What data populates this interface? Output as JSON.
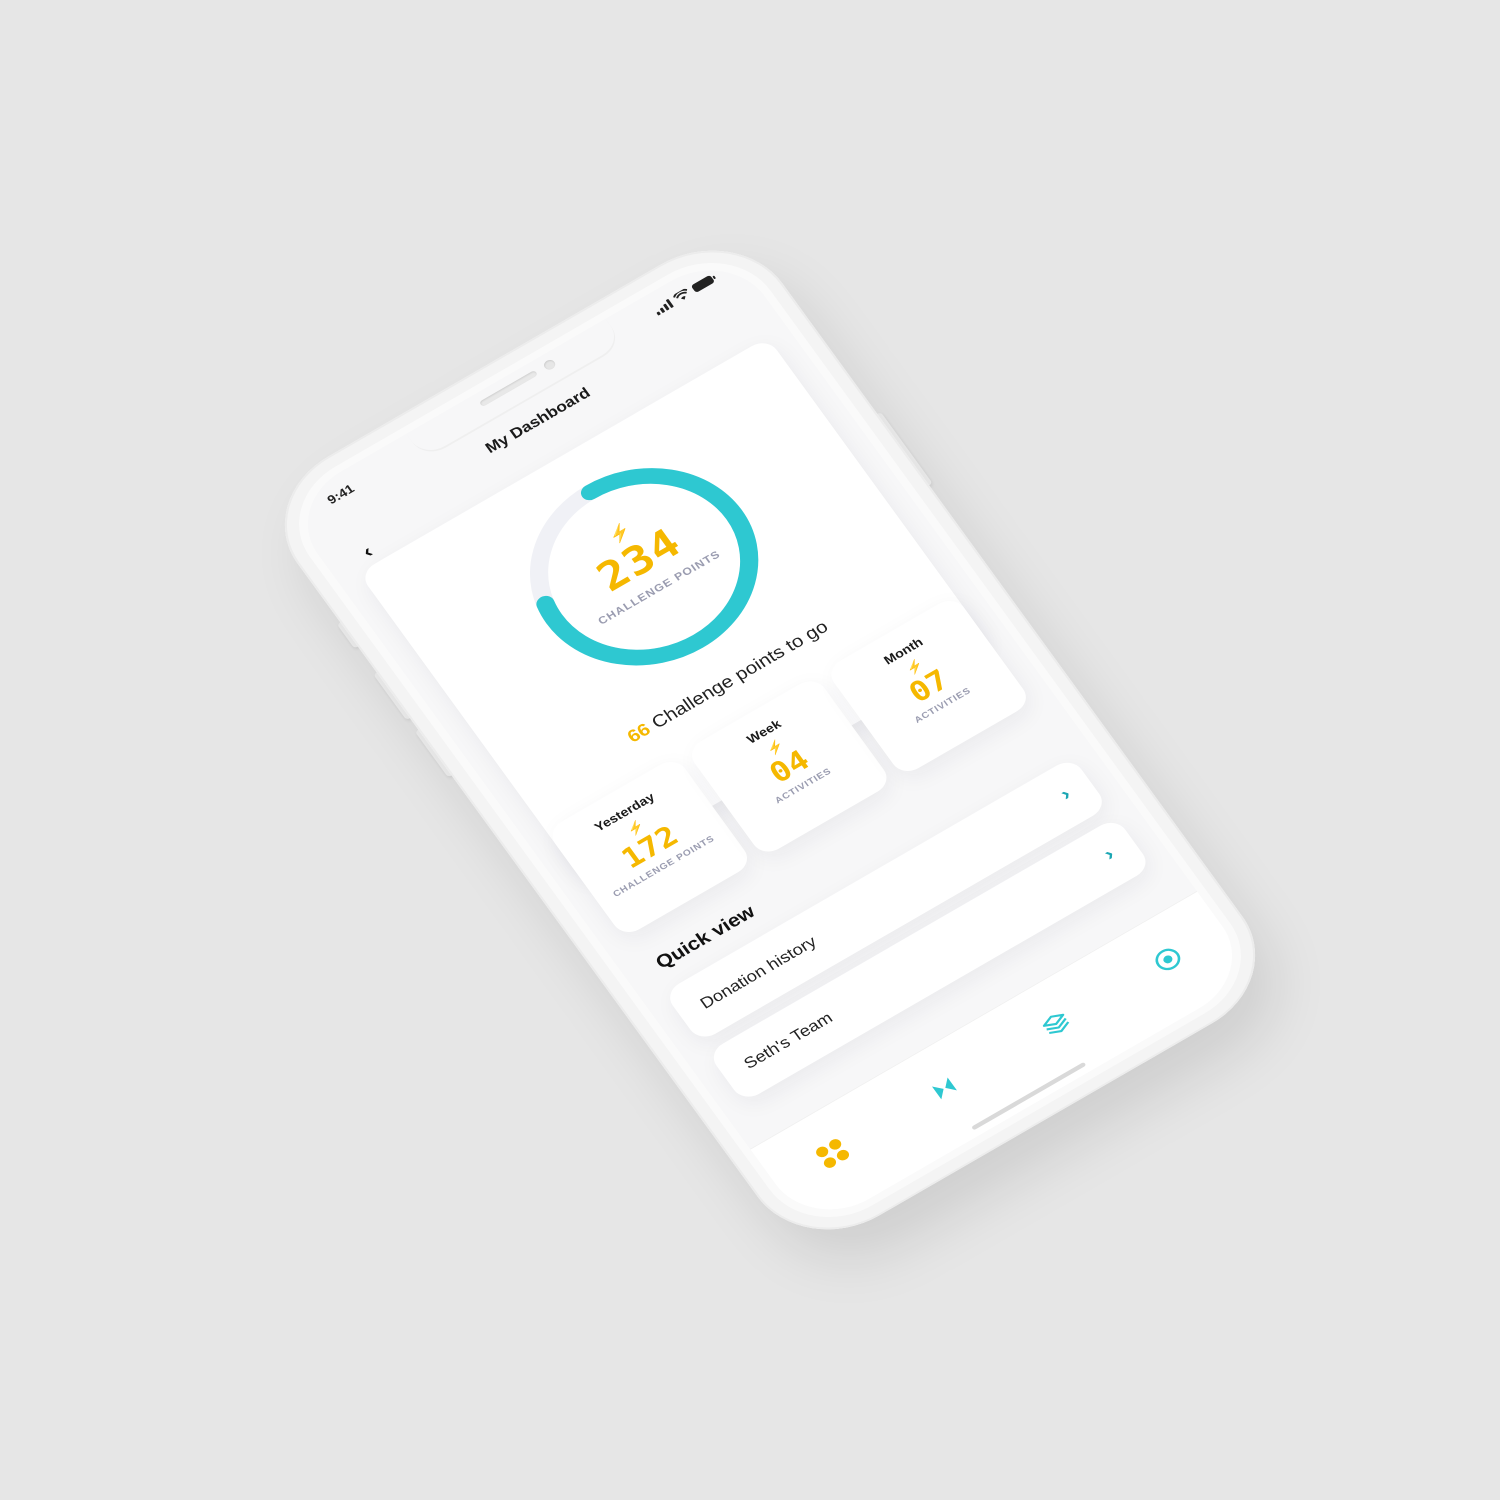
{
  "status_bar": {
    "time": "9:41"
  },
  "nav": {
    "title": "My Dashboard",
    "back_icon": "chevron-left-icon",
    "back_glyph": "‹"
  },
  "summary": {
    "points": "234",
    "points_label": "CHALLENGE POINTS",
    "progress_fraction": 0.78,
    "remaining_value": "66",
    "remaining_text": "Challenge points to go"
  },
  "stats": [
    {
      "title": "Yesterday",
      "value": "172",
      "label": "CHALLENGE POINTS"
    },
    {
      "title": "Week",
      "value": "04",
      "label": "ACTIVITIES"
    },
    {
      "title": "Month",
      "value": "07",
      "label": "ACTIVITIES"
    }
  ],
  "quick_view": {
    "title": "Quick view",
    "items": [
      {
        "label": "Donation history",
        "arrow": "›"
      },
      {
        "label": "Seth's Team",
        "arrow": "›"
      }
    ]
  },
  "tabs": [
    {
      "icon": "home-grid-icon",
      "active": true
    },
    {
      "icon": "bolt-icon",
      "active": false
    },
    {
      "icon": "layers-icon",
      "active": false
    },
    {
      "icon": "profile-circle-icon",
      "active": false
    }
  ],
  "colors": {
    "accent_teal": "#2ec8d1",
    "accent_yellow": "#f5b800",
    "ring_track": "#f0f1f6",
    "background": "#e6e6e6"
  }
}
